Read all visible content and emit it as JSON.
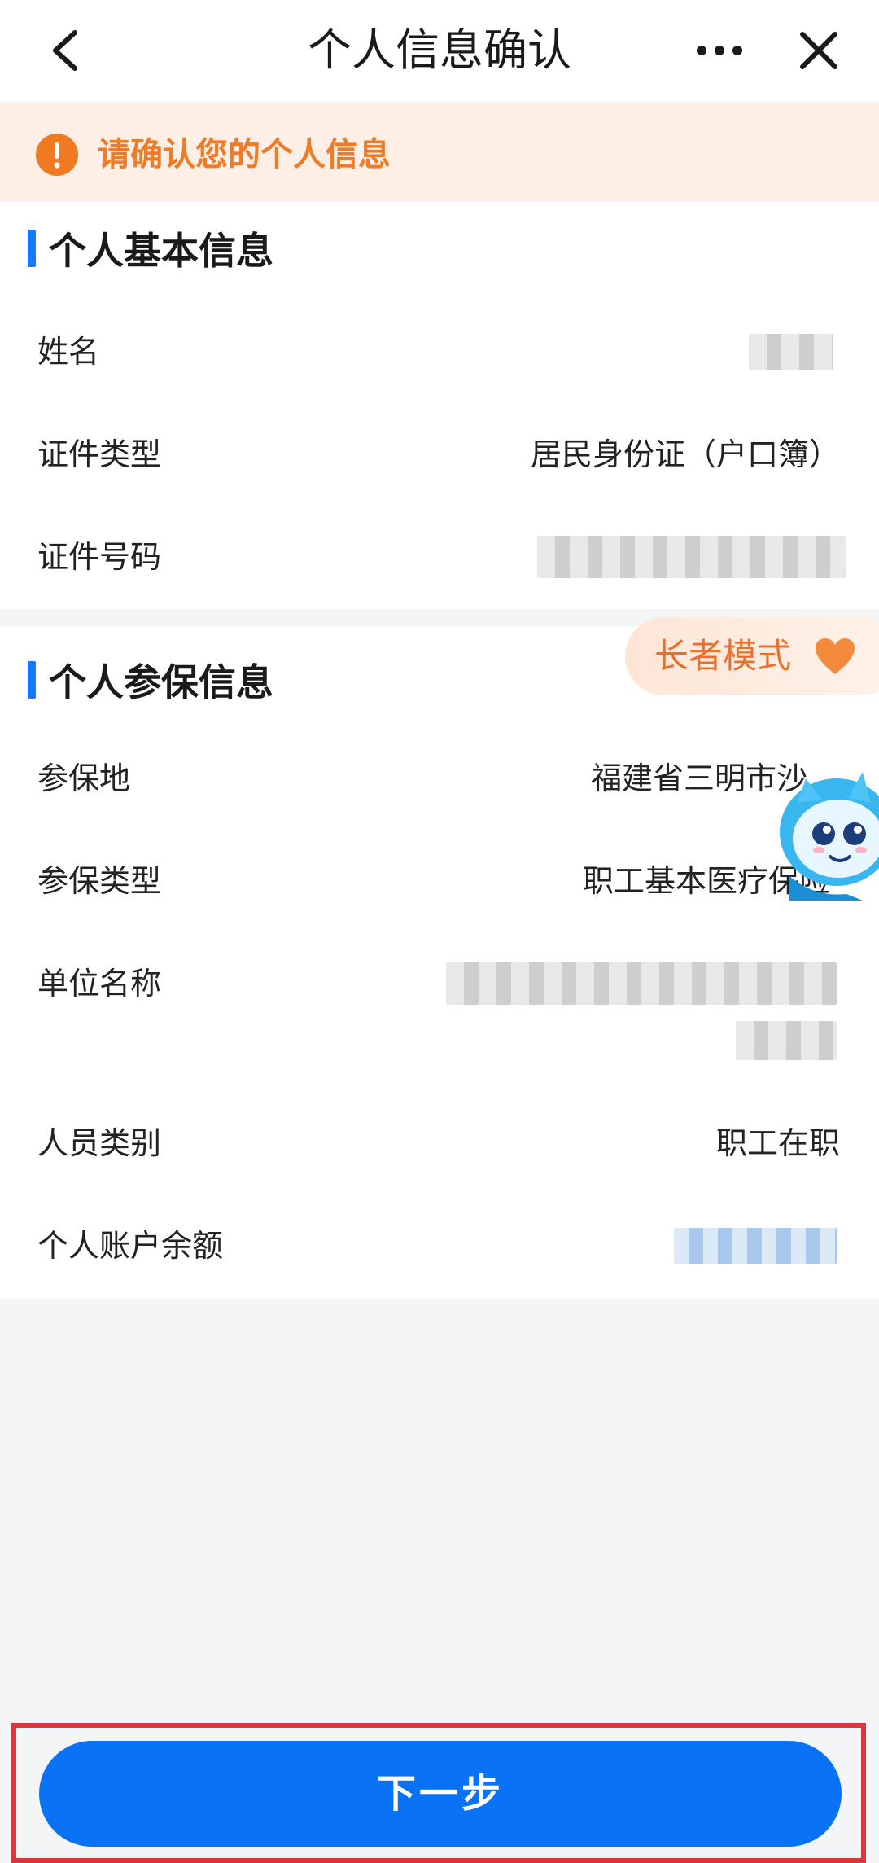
{
  "navbar": {
    "title": "个人信息确认"
  },
  "notice": {
    "text": "请确认您的个人信息",
    "icon": "warning-icon",
    "color": "#ee7b25"
  },
  "basic_info": {
    "title": "个人基本信息",
    "rows": [
      {
        "label": "姓名",
        "value": ""
      },
      {
        "label": "证件类型",
        "value": "居民身份证（户口簿）"
      },
      {
        "label": "证件号码",
        "value": ""
      }
    ]
  },
  "insurance_info": {
    "title": "个人参保信息",
    "rows": [
      {
        "label": "参保地",
        "value": "福建省三明市沙"
      },
      {
        "label": "参保类型",
        "value": "职工基本医疗保险"
      },
      {
        "label": "单位名称",
        "value": ""
      },
      {
        "label": "人员类别",
        "value": "职工在职"
      },
      {
        "label": "个人账户余额",
        "value": ""
      }
    ]
  },
  "elder_mode": {
    "label": "长者模式",
    "icon": "heart-icon"
  },
  "actions": {
    "next_label": "下一步"
  },
  "colors": {
    "accent": "#1677ff",
    "button": "#0a73f5",
    "notice_bg": "#fdeee6",
    "highlight_frame": "#d9363e"
  }
}
